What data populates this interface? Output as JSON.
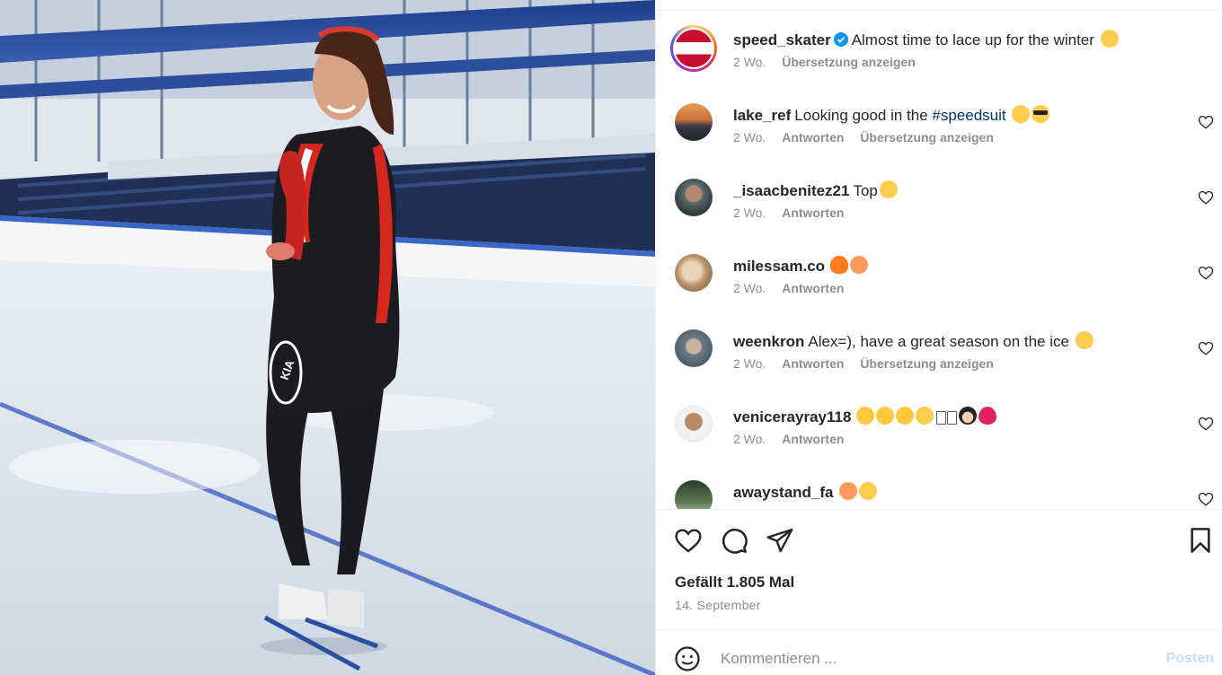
{
  "post": {
    "username": "speed_skater",
    "caption": "Almost time to lace up for the winter",
    "age": "2 Wo.",
    "translate": "Übersetzung anzeigen"
  },
  "comments": [
    {
      "user": "lake_ref",
      "text_before": "Looking good in the ",
      "hashtag": "#speedsuit",
      "text_after": "",
      "emoji": [
        "smirk-emoji",
        "sunglasses-emoji"
      ],
      "age": "2 Wo.",
      "reply": "Antworten",
      "translate": "Übersetzung anzeigen"
    },
    {
      "user": "_isaacbenitez21",
      "text_before": "Top",
      "hashtag": "",
      "text_after": "",
      "emoji": [
        "kiss-emoji"
      ],
      "age": "2 Wo.",
      "reply": "Antworten",
      "translate": ""
    },
    {
      "user": "milessam.co",
      "text_before": "",
      "hashtag": "",
      "text_after": "",
      "emoji": [
        "fire-emoji",
        "peach-emoji"
      ],
      "age": "2 Wo.",
      "reply": "Antworten",
      "translate": ""
    },
    {
      "user": "weenkron",
      "text_before": "Alex=), have a great season on the ice",
      "hashtag": "",
      "text_after": "",
      "emoji": [
        "hearts-face-emoji"
      ],
      "age": "2 Wo.",
      "reply": "Antworten",
      "translate": "Übersetzung anzeigen"
    },
    {
      "user": "venicerayray118",
      "text_before": "",
      "hashtag": "",
      "text_after": "",
      "emoji": [
        "clap-emoji",
        "clap-emoji",
        "clap-emoji",
        "flushed-emoji",
        "unknown-glyph",
        "unknown-glyph",
        "woman-emoji",
        "heart-emoji"
      ],
      "age": "2 Wo.",
      "reply": "Antworten",
      "translate": ""
    },
    {
      "user": "awaystand_fa",
      "text_before": "",
      "hashtag": "",
      "text_after": "",
      "emoji": [
        "peach-emoji",
        "smirk-emoji"
      ],
      "age": "",
      "reply": "",
      "translate": ""
    }
  ],
  "likes": "Gefällt 1.805 Mal",
  "date": "14. September",
  "compose": {
    "placeholder": "Kommentieren ...",
    "post_label": "Posten"
  },
  "colors": {
    "link": "#00376b",
    "muted": "#8e8e8e",
    "text": "#262626",
    "post_disabled": "#c0dffd",
    "verified": "#0095f6"
  },
  "icons": [
    "heart-icon",
    "comment-icon",
    "share-icon",
    "bookmark-icon",
    "emoji-smile-icon",
    "verified-badge-icon"
  ]
}
